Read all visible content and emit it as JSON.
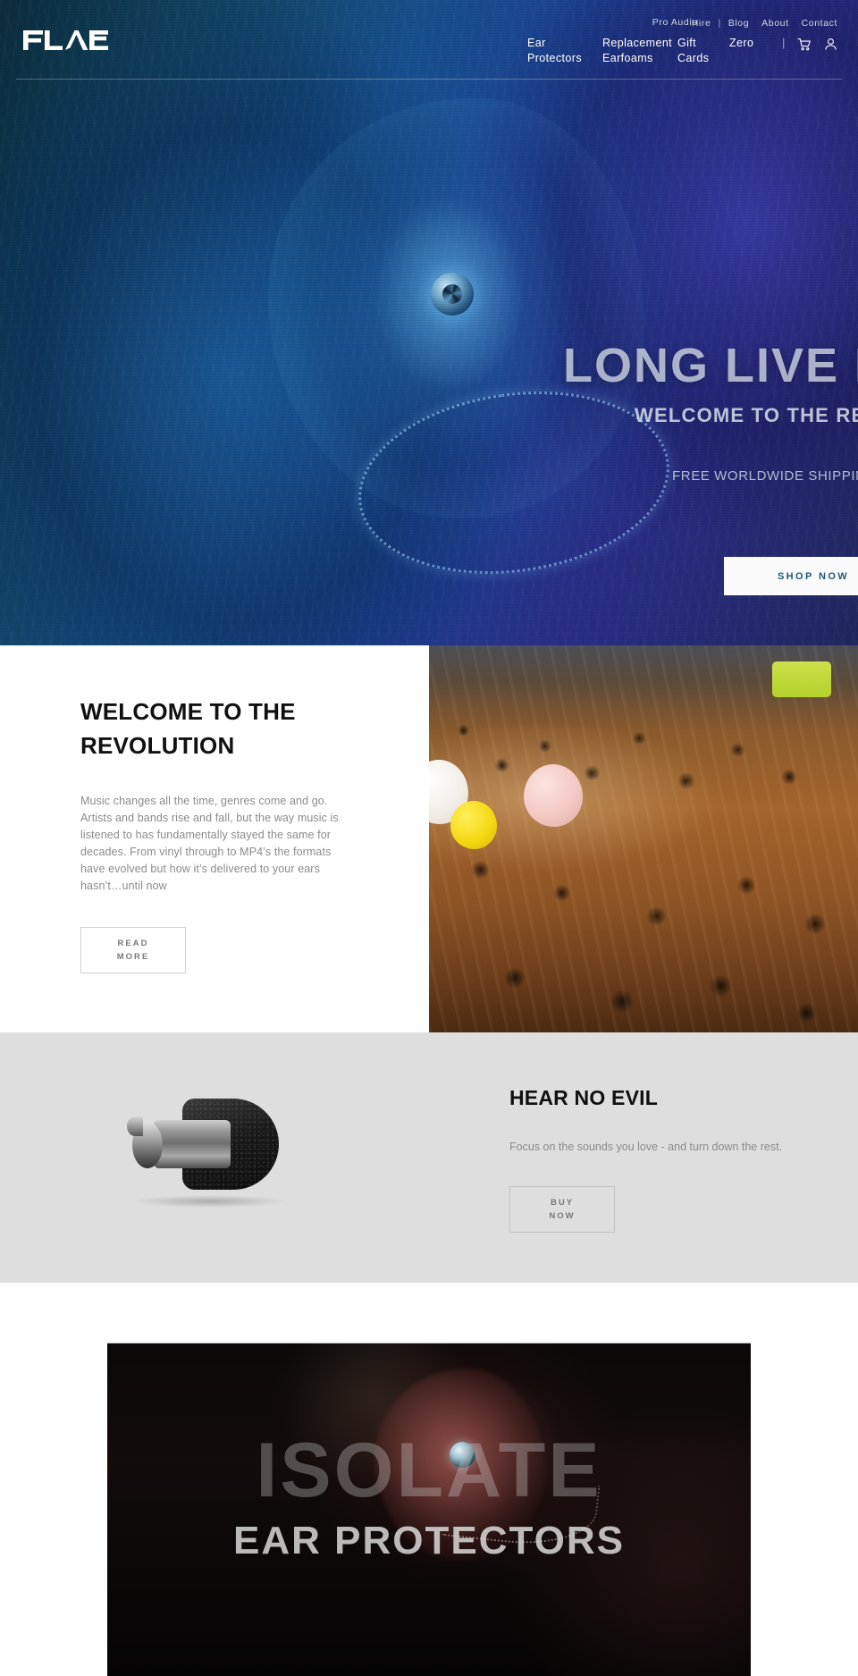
{
  "site": {
    "brand": "FLARE",
    "brand_mark": "®"
  },
  "header": {
    "utility_links": [
      {
        "label": "Pro Audio",
        "name": "pro-audio"
      },
      {
        "label": "Hire",
        "name": "hire"
      },
      {
        "label": "Blog",
        "name": "blog"
      },
      {
        "label": "About",
        "name": "about"
      },
      {
        "label": "Contact",
        "name": "contact"
      }
    ],
    "separator": "|",
    "main_nav": [
      {
        "label": "Ear Protectors",
        "name": "ear-protectors"
      },
      {
        "label": "Replacement Earfoams",
        "name": "replacement-earfoams"
      },
      {
        "label": "Gift Cards",
        "name": "gift-cards"
      },
      {
        "label": "Zero",
        "name": "zero"
      }
    ],
    "icons": [
      {
        "label": "cart-icon",
        "name": "cart-icon"
      },
      {
        "label": "account-icon",
        "name": "account-icon"
      }
    ]
  },
  "hero": {
    "headline": "LONG LIVE MUSIC",
    "subheadline": "WELCOME TO THE REVOLUTION",
    "shipping_note": "FREE WORLDWIDE SHIPPING",
    "cta_label": "SHOP NOW"
  },
  "welcome": {
    "title": "WELCOME TO THE REVOLUTION",
    "body": "Music changes all the time, genres come and go. Artists and bands rise and fall, but the way music is listened to has fundamentally stayed the same for decades. From vinyl through to MP4’s the formats have evolved but how it’s delivered to your ears hasn’t…until now",
    "cta_line1": "READ",
    "cta_line2": "MORE",
    "image_alt": "crowd-at-concert-image"
  },
  "hear_no_evil": {
    "title": "HEAR NO EVIL",
    "body": "Focus on the sounds you love - and turn down the rest.",
    "cta_line1": "BUY",
    "cta_line2": "NOW",
    "image_alt": "ear-protector-product-image"
  },
  "isolate": {
    "title": "ISOLATE",
    "subtitle": "EAR PROTECTORS"
  },
  "colors": {
    "hero_accent": "#1d5a73",
    "page_bg": "#ffffff",
    "section_gray": "#dedede",
    "body_text": "#8b8b8b",
    "heading_text": "#101010"
  }
}
